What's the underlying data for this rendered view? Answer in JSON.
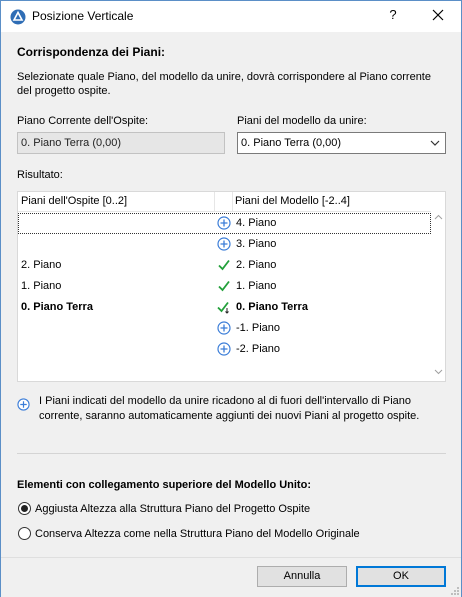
{
  "window": {
    "title": "Posizione Verticale",
    "help_label": "?"
  },
  "section_title": "Corrispondenza dei Piani:",
  "description": "Selezionate quale Piano, del modello da unire, dovrà corrispondere al Piano corrente del progetto ospite.",
  "host_story": {
    "label": "Piano Corrente dell'Ospite:",
    "value": "0. Piano Terra (0,00)"
  },
  "merge_story": {
    "label": "Piani del modello da unire:",
    "value": "0. Piano Terra (0,00)"
  },
  "result": {
    "label": "Risultato:",
    "col_host": "Piani dell'Ospite [0..2]",
    "col_merge": "Piani del Modello [-2..4]",
    "rows": [
      {
        "host": "",
        "status": "plus",
        "merge": "4. Piano",
        "bold": false,
        "selected": true
      },
      {
        "host": "",
        "status": "plus",
        "merge": "3. Piano",
        "bold": false,
        "selected": false
      },
      {
        "host": "2. Piano",
        "status": "check",
        "merge": "2. Piano",
        "bold": false,
        "selected": false
      },
      {
        "host": "1. Piano",
        "status": "check",
        "merge": "1. Piano",
        "bold": false,
        "selected": false
      },
      {
        "host": "0. Piano Terra",
        "status": "check-current",
        "merge": "0. Piano Terra",
        "bold": true,
        "selected": false
      },
      {
        "host": "",
        "status": "plus",
        "merge": "-1. Piano",
        "bold": false,
        "selected": false
      },
      {
        "host": "",
        "status": "plus",
        "merge": "-2. Piano",
        "bold": false,
        "selected": false
      }
    ]
  },
  "note": "I Piani indicati del modello da unire ricadono al di fuori dell'intervallo di Piano corrente, saranno automaticamente aggiunti dei nuovi Piani al progetto ospite.",
  "linked_section": {
    "title": "Elementi con collegamento superiore del Modello Unito:",
    "options": [
      {
        "label": "Aggiusta Altezza alla Struttura Piano del Progetto Ospite",
        "selected": true
      },
      {
        "label": "Conserva Altezza come nella Struttura Piano del Modello Originale",
        "selected": false
      }
    ]
  },
  "buttons": {
    "cancel": "Annulla",
    "ok": "OK"
  },
  "colors": {
    "accent": "#0078d7",
    "plus_icon": "#3b7dd8",
    "check": "#22a03a"
  }
}
